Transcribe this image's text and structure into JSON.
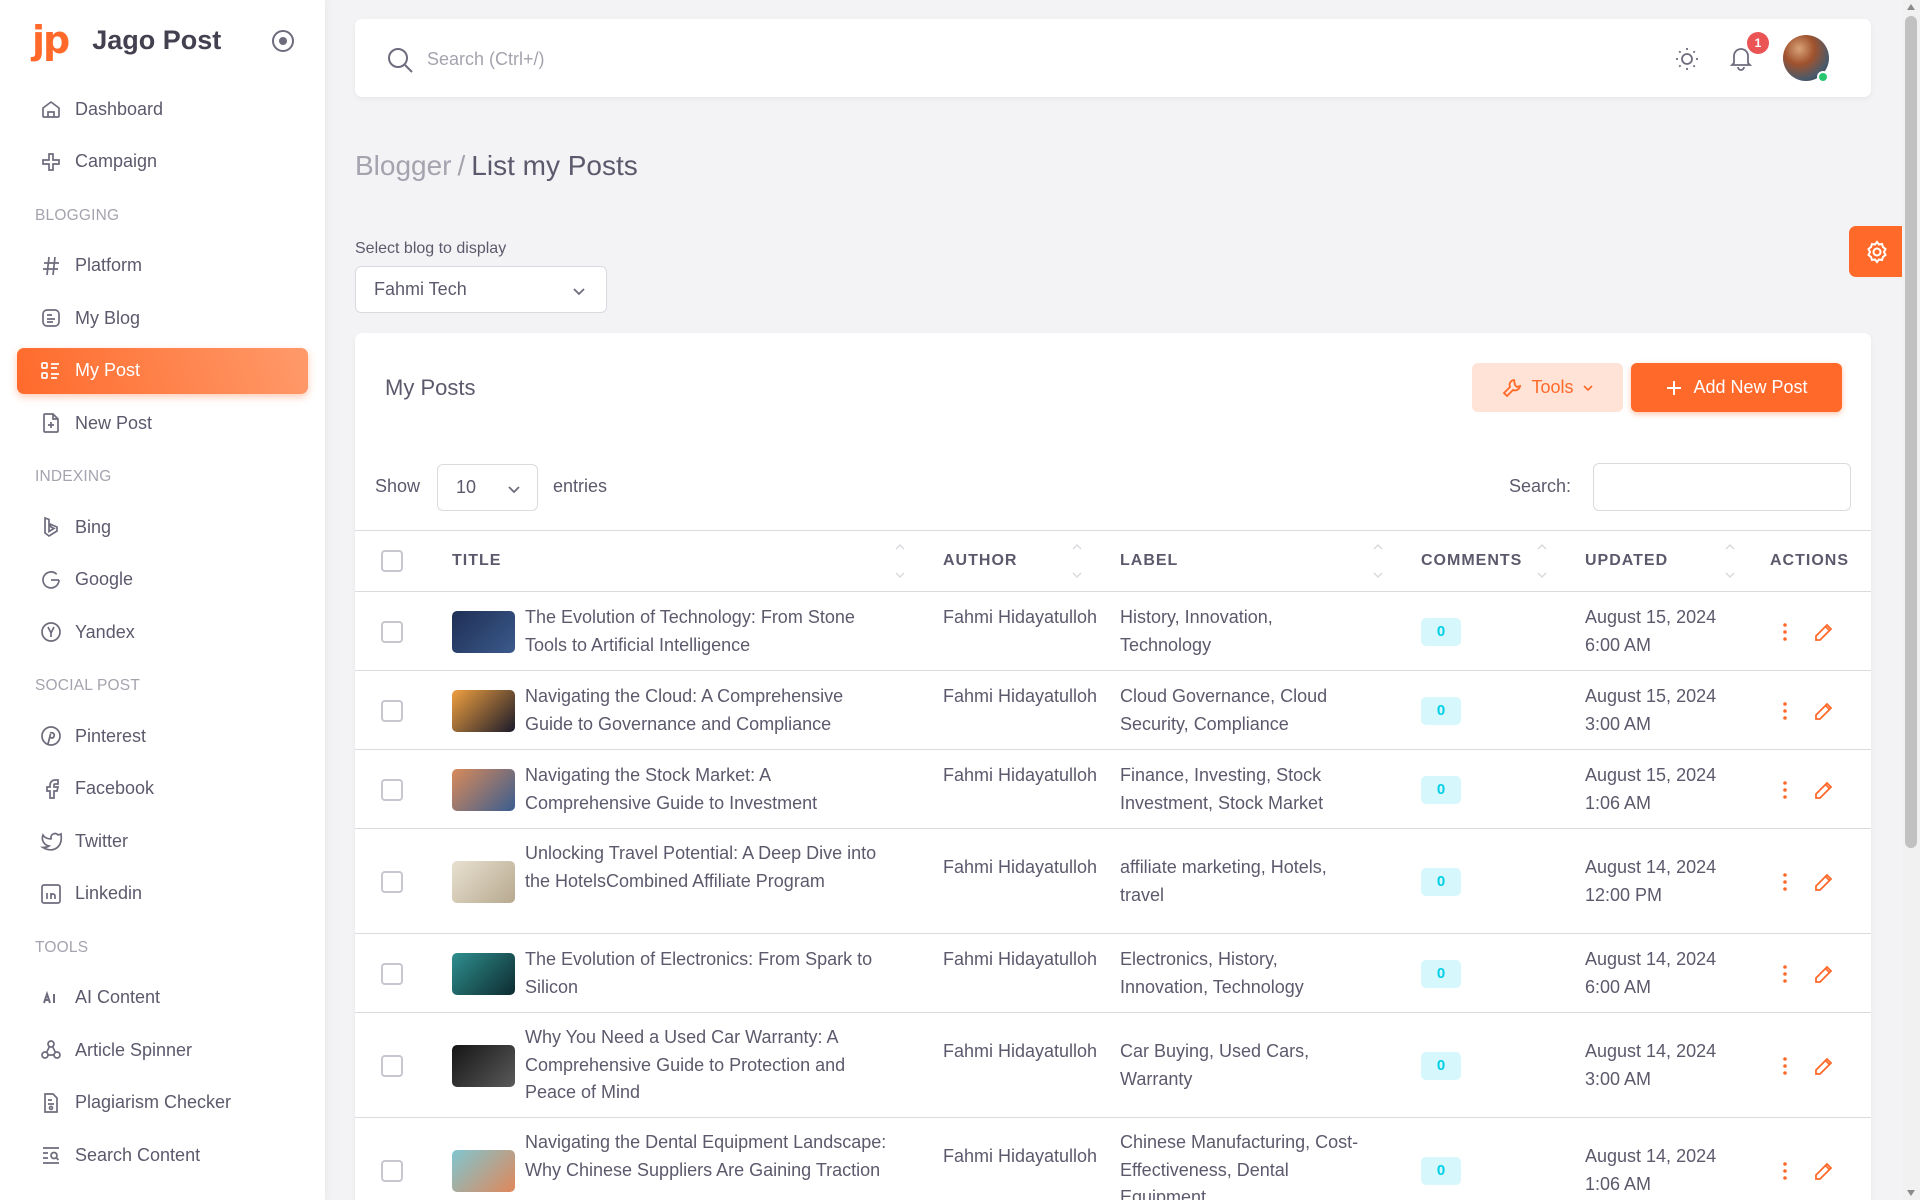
{
  "brand": {
    "logo": "jp",
    "name": "Jago Post"
  },
  "sidebar": {
    "top_items": [
      {
        "label": "Dashboard",
        "icon": "home-icon"
      },
      {
        "label": "Campaign",
        "icon": "campaign-icon"
      }
    ],
    "sections": [
      {
        "header": "BLOGGING",
        "items": [
          {
            "label": "Platform",
            "icon": "hash-icon"
          },
          {
            "label": "My Blog",
            "icon": "blog-icon"
          },
          {
            "label": "My Post",
            "icon": "list-details-icon",
            "active": true
          },
          {
            "label": "New Post",
            "icon": "file-plus-icon"
          }
        ]
      },
      {
        "header": "INDEXING",
        "items": [
          {
            "label": "Bing",
            "icon": "bing-icon"
          },
          {
            "label": "Google",
            "icon": "google-icon"
          },
          {
            "label": "Yandex",
            "icon": "yandex-icon"
          }
        ]
      },
      {
        "header": "SOCIAL POST",
        "items": [
          {
            "label": "Pinterest",
            "icon": "pinterest-icon"
          },
          {
            "label": "Facebook",
            "icon": "facebook-icon"
          },
          {
            "label": "Twitter",
            "icon": "twitter-icon"
          },
          {
            "label": "Linkedin",
            "icon": "linkedin-icon"
          }
        ]
      },
      {
        "header": "TOOLS",
        "items": [
          {
            "label": "AI Content",
            "icon": "ai-icon"
          },
          {
            "label": "Article Spinner",
            "icon": "spinner-icon"
          },
          {
            "label": "Plagiarism Checker",
            "icon": "plagiarism-icon"
          },
          {
            "label": "Search Content",
            "icon": "search-content-icon"
          }
        ]
      }
    ]
  },
  "navbar": {
    "search_placeholder": "Search (Ctrl+/)",
    "notification_count": "1"
  },
  "breadcrumb": {
    "parent": "Blogger",
    "separator": "/",
    "current": "List my Posts"
  },
  "blog_select": {
    "label": "Select blog to display",
    "value": "Fahmi Tech"
  },
  "card": {
    "title": "My Posts",
    "tools_label": "Tools",
    "add_label": "Add New Post"
  },
  "table_controls": {
    "show_label": "Show",
    "entries_value": "10",
    "entries_label": "entries",
    "search_label": "Search:"
  },
  "columns": [
    "TITLE",
    "AUTHOR",
    "LABEL",
    "COMMENTS",
    "UPDATED",
    "ACTIONS"
  ],
  "rows": [
    {
      "title": "The Evolution of Technology: From Stone Tools to Artificial Intelligence",
      "author": "Fahmi Hidayatulloh",
      "label": "History, Innovation, Technology",
      "comments": "0",
      "updated": "August 15, 2024 6:00 AM",
      "thumb_colors": [
        "#1f2f55",
        "#3b5a8c"
      ]
    },
    {
      "title": "Navigating the Cloud: A Comprehensive Guide to Governance and Compliance",
      "author": "Fahmi Hidayatulloh",
      "label": "Cloud Governance, Cloud Security, Compliance",
      "comments": "0",
      "updated": "August 15, 2024 3:00 AM",
      "thumb_colors": [
        "#f0a040",
        "#1a1a2a"
      ]
    },
    {
      "title": "Navigating the Stock Market: A Comprehensive Guide to Investment",
      "author": "Fahmi Hidayatulloh",
      "label": "Finance, Investing, Stock Investment, Stock Market",
      "comments": "0",
      "updated": "August 15, 2024 1:06 AM",
      "thumb_colors": [
        "#d98a5a",
        "#3a5d8f"
      ]
    },
    {
      "title": "Unlocking Travel Potential: A Deep Dive into the HotelsCombined Affiliate Program",
      "author": "Fahmi Hidayatulloh",
      "label": "affiliate marketing, Hotels, travel",
      "comments": "0",
      "updated": "August 14, 2024 12:00 PM",
      "thumb_colors": [
        "#e8e0d0",
        "#b7a98f"
      ]
    },
    {
      "title": "The Evolution of Electronics: From Spark to Silicon",
      "author": "Fahmi Hidayatulloh",
      "label": "Electronics, History, Innovation, Technology",
      "comments": "0",
      "updated": "August 14, 2024 6:00 AM",
      "thumb_colors": [
        "#2f8f8f",
        "#0d2b2f"
      ]
    },
    {
      "title": "Why You Need a Used Car Warranty: A Comprehensive Guide to Protection and Peace of Mind",
      "author": "Fahmi Hidayatulloh",
      "label": "Car Buying, Used Cars, Warranty",
      "comments": "0",
      "updated": "August 14, 2024 3:00 AM",
      "thumb_colors": [
        "#151515",
        "#5a5a5a"
      ]
    },
    {
      "title": "Navigating the Dental Equipment Landscape: Why Chinese Suppliers Are Gaining Traction",
      "author": "Fahmi Hidayatulloh",
      "label": "Chinese Manufacturing, Cost-Effectiveness, Dental Equipment",
      "comments": "0",
      "updated": "August 14, 2024 1:06 AM",
      "thumb_colors": [
        "#7fc6d0",
        "#e0875a"
      ]
    }
  ],
  "colors": {
    "accent": "#ff6a2b",
    "badge": "#ea5455",
    "info": "#00cfe8",
    "online": "#28c76f"
  }
}
